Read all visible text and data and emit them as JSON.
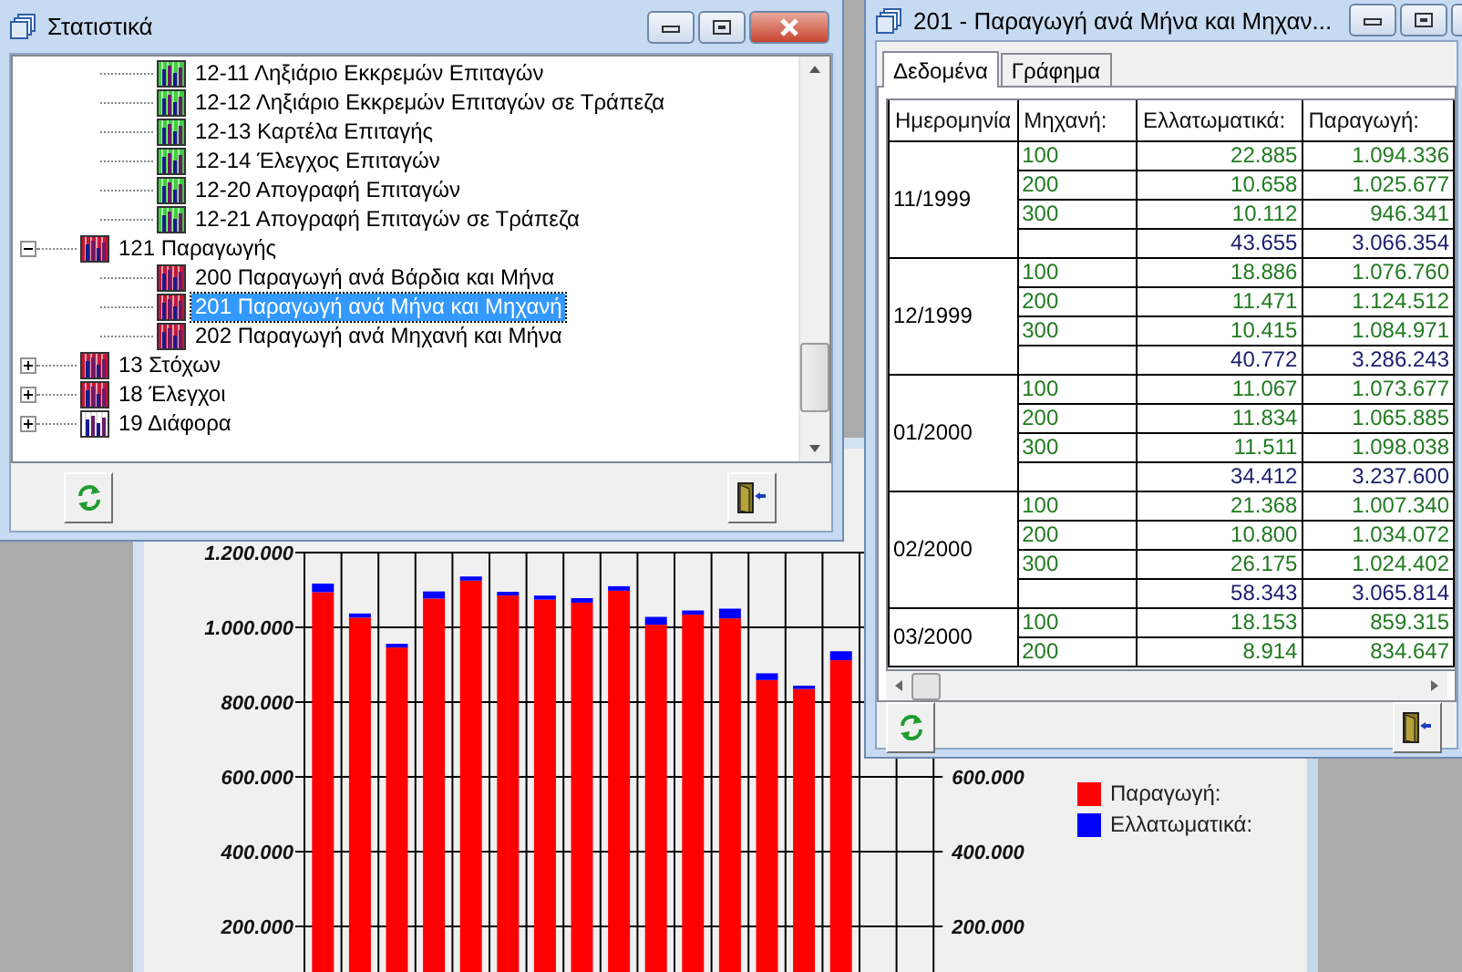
{
  "tree_window": {
    "title": "Στατιστικά",
    "tree": {
      "continued_items": [
        {
          "label": "12-11 Ληξιάριο Εκκρεμών Επιταγών",
          "selected": false
        },
        {
          "label": "12-12 Ληξιάριο Εκκρεμών Επιταγών σε Τράπεζα",
          "selected": false
        },
        {
          "label": "12-13 Καρτέλα Επιταγής",
          "selected": false
        },
        {
          "label": "12-14 Έλεγχος Επιταγών",
          "selected": false
        },
        {
          "label": "12-20 Απογραφή Επιταγών",
          "selected": false
        },
        {
          "label": "12-21 Απογραφή Επιταγών σε Τράπεζα",
          "selected": false
        }
      ],
      "items": [
        {
          "label": "121 Παραγωγής",
          "selected": false,
          "expanded": true,
          "children": [
            {
              "label": "200 Παραγωγή ανά Βάρδια και Μήνα",
              "selected": false
            },
            {
              "label": "201 Παραγωγή ανά Μήνα και Μηχανή",
              "selected": true
            },
            {
              "label": "202 Παραγωγή ανά Μηχανή και Μήνα",
              "selected": false
            }
          ]
        },
        {
          "label": "13 Στόχων",
          "selected": false,
          "expanded": false
        },
        {
          "label": "18 Έλεγχοι",
          "selected": false,
          "expanded": false
        },
        {
          "label": "19 Διάφορα",
          "selected": false,
          "expanded": false
        }
      ]
    }
  },
  "chart_window": {
    "chart_data": {
      "type": "bar",
      "stacked": true,
      "grid": true,
      "ylim": [
        0,
        1200000
      ],
      "yticks": [
        {
          "value": 200000,
          "label": "200.000"
        },
        {
          "value": 400000,
          "label": "400.000"
        },
        {
          "value": 600000,
          "label": "600.000"
        },
        {
          "value": 800000,
          "label": "800.000"
        },
        {
          "value": 1000000,
          "label": "1.000.000"
        },
        {
          "value": 1200000,
          "label": "1.200.000"
        }
      ],
      "series": [
        {
          "name": "Παραγωγή:",
          "color": "#ff0000",
          "values": [
            1094000,
            1026000,
            946000,
            1077000,
            1125000,
            1085000,
            1074000,
            1066000,
            1098000,
            1007000,
            1034000,
            1024000,
            859000,
            835000,
            912000
          ]
        },
        {
          "name": "Ελλατωματικά:",
          "color": "#0000ff",
          "values": [
            23000,
            11000,
            10000,
            19000,
            11000,
            10000,
            11000,
            12000,
            12000,
            21000,
            11000,
            26000,
            18000,
            9000,
            24000
          ]
        }
      ]
    },
    "right_axis_ticks": [
      "600.000",
      "400.000",
      "200.000"
    ]
  },
  "report_window": {
    "title": "201 - Παραγωγή ανά Μήνα και Μηχαν...",
    "tabs": [
      {
        "label": "Δεδομένα",
        "selected": true
      },
      {
        "label": "Γράφημα",
        "selected": false
      }
    ],
    "table": {
      "columns": [
        "Ημερομηνία",
        "Μηχανή:",
        "Ελλατωματικά:",
        "Παραγωγή:"
      ],
      "groups": [
        {
          "date": "11/1999",
          "rows": [
            {
              "kind": "machine",
              "machine": "100",
              "defects": "22.885",
              "production": "1.094.336"
            },
            {
              "kind": "machine",
              "machine": "200",
              "defects": "10.658",
              "production": "1.025.677"
            },
            {
              "kind": "machine",
              "machine": "300",
              "defects": "10.112",
              "production": "946.341"
            },
            {
              "kind": "total",
              "defects": "43.655",
              "production": "3.066.354"
            }
          ]
        },
        {
          "date": "12/1999",
          "rows": [
            {
              "kind": "machine",
              "machine": "100",
              "defects": "18.886",
              "production": "1.076.760"
            },
            {
              "kind": "machine",
              "machine": "200",
              "defects": "11.471",
              "production": "1.124.512"
            },
            {
              "kind": "machine",
              "machine": "300",
              "defects": "10.415",
              "production": "1.084.971"
            },
            {
              "kind": "total",
              "defects": "40.772",
              "production": "3.286.243"
            }
          ]
        },
        {
          "date": "01/2000",
          "rows": [
            {
              "kind": "machine",
              "machine": "100",
              "defects": "11.067",
              "production": "1.073.677"
            },
            {
              "kind": "machine",
              "machine": "200",
              "defects": "11.834",
              "production": "1.065.885"
            },
            {
              "kind": "machine",
              "machine": "300",
              "defects": "11.511",
              "production": "1.098.038"
            },
            {
              "kind": "total",
              "defects": "34.412",
              "production": "3.237.600"
            }
          ]
        },
        {
          "date": "02/2000",
          "rows": [
            {
              "kind": "machine",
              "machine": "100",
              "defects": "21.368",
              "production": "1.007.340"
            },
            {
              "kind": "machine",
              "machine": "200",
              "defects": "10.800",
              "production": "1.034.072"
            },
            {
              "kind": "machine",
              "machine": "300",
              "defects": "26.175",
              "production": "1.024.402"
            },
            {
              "kind": "total",
              "defects": "58.343",
              "production": "3.065.814"
            }
          ]
        },
        {
          "date": "03/2000",
          "rows": [
            {
              "kind": "machine",
              "machine": "100",
              "defects": "18.153",
              "production": "859.315"
            },
            {
              "kind": "machine",
              "machine": "200",
              "defects": "8.914",
              "production": "834.647"
            }
          ]
        }
      ]
    }
  }
}
